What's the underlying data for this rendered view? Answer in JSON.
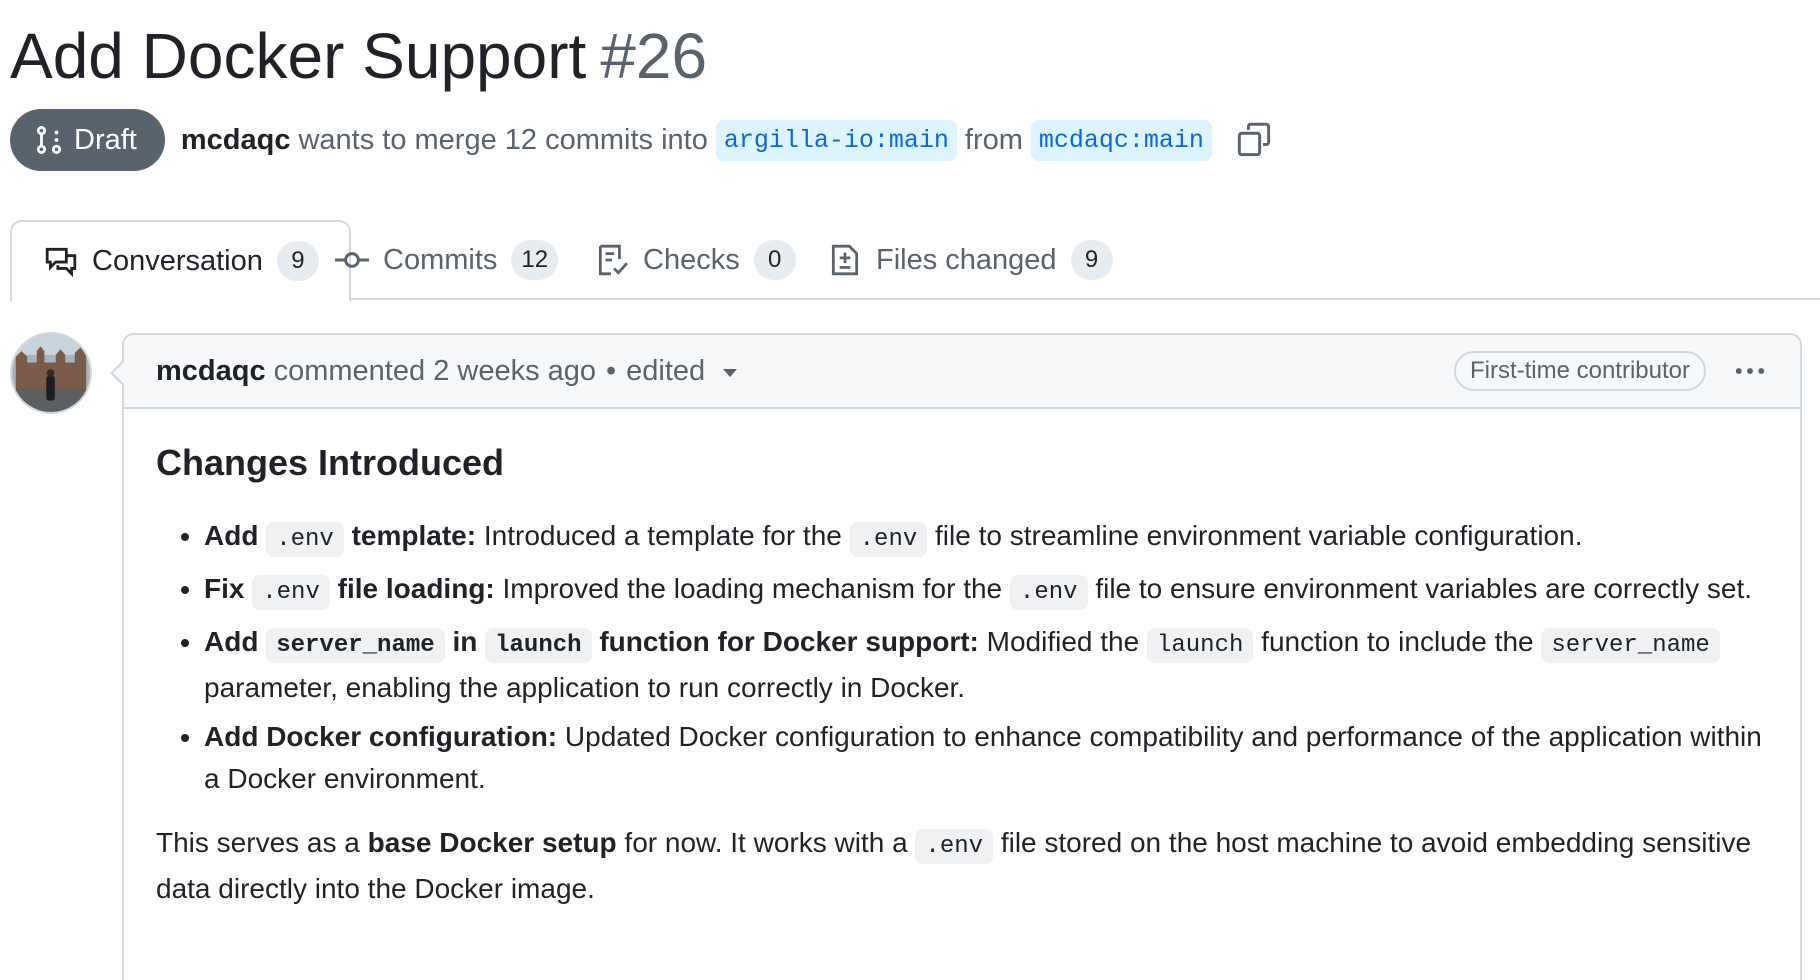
{
  "pr": {
    "title": "Add Docker Support",
    "number": "#26",
    "state": "Draft",
    "author": "mcdaqc",
    "merge_text": "wants to merge 12 commits into",
    "base_branch": "argilla-io:main",
    "from_text": "from",
    "head_branch": "mcdaqc:main"
  },
  "tabs": [
    {
      "label": "Conversation",
      "count": "9",
      "icon": "comment-discussion-icon"
    },
    {
      "label": "Commits",
      "count": "12",
      "icon": "git-commit-icon"
    },
    {
      "label": "Checks",
      "count": "0",
      "icon": "checklist-icon"
    },
    {
      "label": "Files changed",
      "count": "9",
      "icon": "file-diff-icon"
    }
  ],
  "comment": {
    "author": "mcdaqc",
    "action": "commented",
    "time": "2 weeks ago",
    "separator": "•",
    "edited": "edited",
    "badge": "First-time contributor",
    "heading": "Changes Introduced",
    "bullets": [
      {
        "b1": "Add",
        "c1": ".env",
        "b2": "template:",
        "t1": "Introduced a template for the",
        "c2": ".env",
        "t2": "file to streamline environment variable configuration."
      },
      {
        "b1": "Fix",
        "c1": ".env",
        "b2": "file loading:",
        "t1": "Improved the loading mechanism for the",
        "c2": ".env",
        "t2": "file to ensure environment variables are correctly set."
      },
      {
        "b1": "Add",
        "c1": "server_name",
        "b2": "in",
        "c2": "launch",
        "b3": "function for Docker support:",
        "t1": "Modified the",
        "c3": "launch",
        "t2": "function to include the",
        "c4": "server_name",
        "t3": "parameter, enabling the application to run correctly in Docker."
      },
      {
        "b1": "Add Docker configuration:",
        "t1": "Updated Docker configuration to enhance compatibility and performance of the application within a Docker environment."
      }
    ],
    "para": {
      "t1": "This serves as a",
      "b1": "base Docker setup",
      "t2": "for now. It works with a",
      "c1": ".env",
      "t3": "file stored on the host machine to avoid embedding sensitive data directly into the Docker image."
    }
  }
}
